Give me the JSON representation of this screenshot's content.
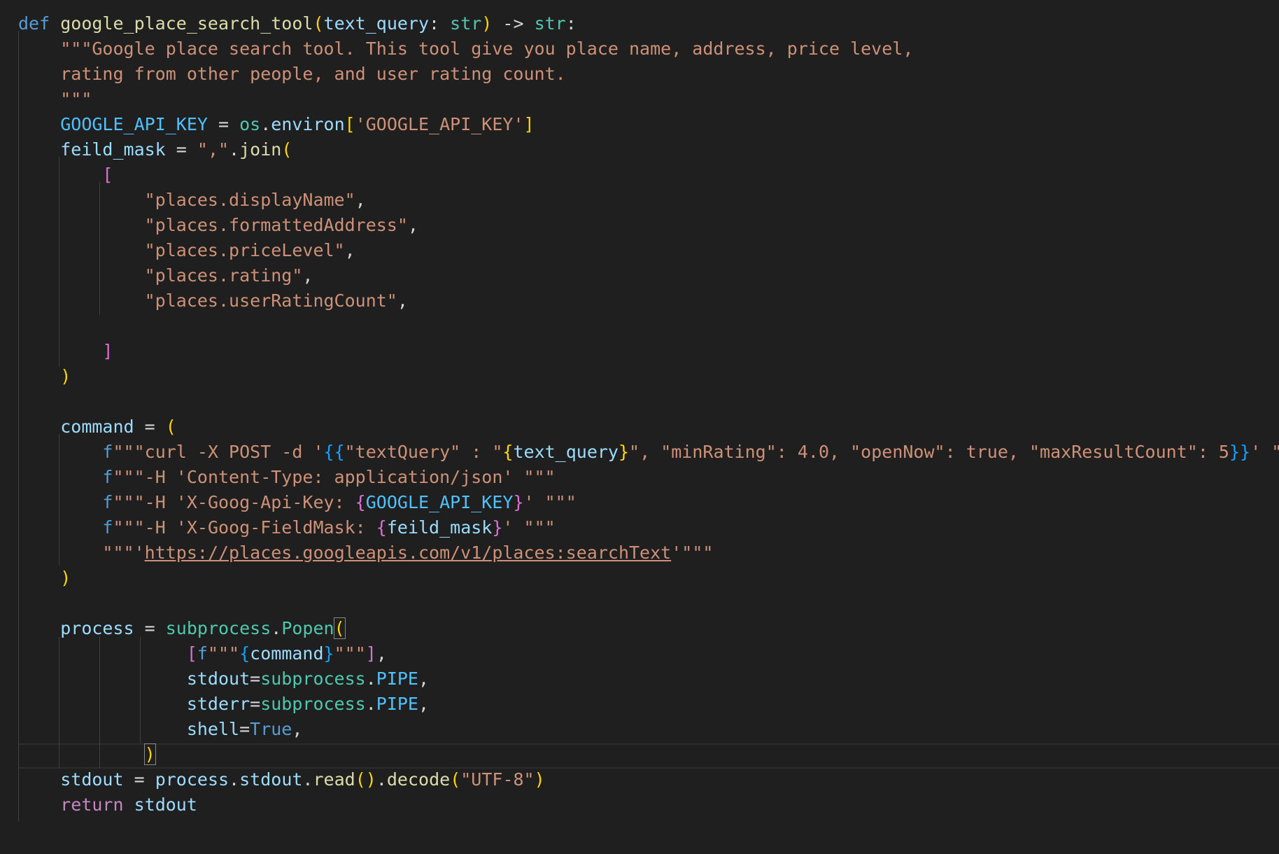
{
  "editor": {
    "language": "python",
    "theme_colors": {
      "background": "#1f1f1f",
      "keyword": "#569cd6",
      "control": "#c586c0",
      "function": "#dcdcaa",
      "parameter": "#9cdcfe",
      "type": "#4ec9b0",
      "string": "#ce9178",
      "bracket_level_1": "#ffd700",
      "bracket_level_2": "#da70d6",
      "bracket_level_3": "#179fff"
    },
    "active_line": 30,
    "lines": [
      [
        [
          "kw",
          "def"
        ],
        [
          "op",
          " "
        ],
        [
          "fn",
          "google_place_search_tool"
        ],
        [
          "brk1",
          "("
        ],
        [
          "par",
          "text_query"
        ],
        [
          "op",
          ": "
        ],
        [
          "type",
          "str"
        ],
        [
          "brk1",
          ")"
        ],
        [
          "op",
          " -> "
        ],
        [
          "type",
          "str"
        ],
        [
          "op",
          ":"
        ]
      ],
      [
        [
          "op",
          "    "
        ],
        [
          "str",
          "\"\"\"Google place search tool. This tool give you place name, address, price level,"
        ]
      ],
      [
        [
          "op",
          "    "
        ],
        [
          "str",
          "rating from other people, and user rating count."
        ]
      ],
      [
        [
          "op",
          "    "
        ],
        [
          "str",
          "\"\"\""
        ]
      ],
      [
        [
          "op",
          "    "
        ],
        [
          "const",
          "GOOGLE_API_KEY"
        ],
        [
          "op",
          " = "
        ],
        [
          "type",
          "os"
        ],
        [
          "op",
          "."
        ],
        [
          "var",
          "environ"
        ],
        [
          "brk1",
          "["
        ],
        [
          "str",
          "'GOOGLE_API_KEY'"
        ],
        [
          "brk1",
          "]"
        ]
      ],
      [
        [
          "op",
          "    "
        ],
        [
          "var",
          "feild_mask"
        ],
        [
          "op",
          " = "
        ],
        [
          "str",
          "\",\""
        ],
        [
          "op",
          "."
        ],
        [
          "fn",
          "join"
        ],
        [
          "brk1",
          "("
        ]
      ],
      [
        [
          "op",
          "        "
        ],
        [
          "brk2",
          "["
        ]
      ],
      [
        [
          "op",
          "            "
        ],
        [
          "str",
          "\"places.displayName\""
        ],
        [
          "op",
          ","
        ]
      ],
      [
        [
          "op",
          "            "
        ],
        [
          "str",
          "\"places.formattedAddress\""
        ],
        [
          "op",
          ","
        ]
      ],
      [
        [
          "op",
          "            "
        ],
        [
          "str",
          "\"places.priceLevel\""
        ],
        [
          "op",
          ","
        ]
      ],
      [
        [
          "op",
          "            "
        ],
        [
          "str",
          "\"places.rating\""
        ],
        [
          "op",
          ","
        ]
      ],
      [
        [
          "op",
          "            "
        ],
        [
          "str",
          "\"places.userRatingCount\""
        ],
        [
          "op",
          ","
        ]
      ],
      [],
      [
        [
          "op",
          "        "
        ],
        [
          "brk2",
          "]"
        ]
      ],
      [
        [
          "op",
          "    "
        ],
        [
          "brk1",
          ")"
        ]
      ],
      [],
      [
        [
          "op",
          "    "
        ],
        [
          "var",
          "command"
        ],
        [
          "op",
          " = "
        ],
        [
          "brk1",
          "("
        ]
      ],
      [
        [
          "op",
          "        "
        ],
        [
          "fs",
          "f"
        ],
        [
          "str",
          "\"\"\"curl -X POST -d '"
        ],
        [
          "brk3",
          "{{"
        ],
        [
          "str",
          "\"textQuery\" : \""
        ],
        [
          "brk1",
          "{"
        ],
        [
          "var",
          "text_query"
        ],
        [
          "brk1",
          "}"
        ],
        [
          "str",
          "\", \"minRating\": 4.0, \"openNow\": true, \"maxResultCount\": 5"
        ],
        [
          "brk3",
          "}}"
        ],
        [
          "str",
          "' \"\"\""
        ]
      ],
      [
        [
          "op",
          "        "
        ],
        [
          "fs",
          "f"
        ],
        [
          "str",
          "\"\"\"-H 'Content-Type: application/json' \"\"\""
        ]
      ],
      [
        [
          "op",
          "        "
        ],
        [
          "fs",
          "f"
        ],
        [
          "str",
          "\"\"\"-H 'X-Goog-Api-Key: "
        ],
        [
          "brk2",
          "{"
        ],
        [
          "const",
          "GOOGLE_API_KEY"
        ],
        [
          "brk2",
          "}"
        ],
        [
          "str",
          "' \"\"\""
        ]
      ],
      [
        [
          "op",
          "        "
        ],
        [
          "fs",
          "f"
        ],
        [
          "str",
          "\"\"\"-H 'X-Goog-FieldMask: "
        ],
        [
          "brk2",
          "{"
        ],
        [
          "var",
          "feild_mask"
        ],
        [
          "brk2",
          "}"
        ],
        [
          "str",
          "' \"\"\""
        ]
      ],
      [
        [
          "op",
          "        "
        ],
        [
          "str",
          "\"\"\"'"
        ],
        [
          "url",
          "https://places.googleapis.com/v1/places:searchText"
        ],
        [
          "str",
          "'\"\"\""
        ]
      ],
      [
        [
          "op",
          "    "
        ],
        [
          "brk1",
          ")"
        ]
      ],
      [],
      [
        [
          "op",
          "    "
        ],
        [
          "var",
          "process"
        ],
        [
          "op",
          " = "
        ],
        [
          "type",
          "subprocess"
        ],
        [
          "op",
          "."
        ],
        [
          "type",
          "Popen"
        ],
        [
          "brk1bm",
          "("
        ]
      ],
      [
        [
          "op",
          "                "
        ],
        [
          "brk2",
          "["
        ],
        [
          "fs",
          "f"
        ],
        [
          "str",
          "\"\"\""
        ],
        [
          "brk3",
          "{"
        ],
        [
          "var",
          "command"
        ],
        [
          "brk3",
          "}"
        ],
        [
          "str",
          "\"\"\""
        ],
        [
          "brk2",
          "]"
        ],
        [
          "op",
          ","
        ]
      ],
      [
        [
          "op",
          "                "
        ],
        [
          "par",
          "stdout"
        ],
        [
          "op",
          "="
        ],
        [
          "type",
          "subprocess"
        ],
        [
          "op",
          "."
        ],
        [
          "const",
          "PIPE"
        ],
        [
          "op",
          ","
        ]
      ],
      [
        [
          "op",
          "                "
        ],
        [
          "par",
          "stderr"
        ],
        [
          "op",
          "="
        ],
        [
          "type",
          "subprocess"
        ],
        [
          "op",
          "."
        ],
        [
          "const",
          "PIPE"
        ],
        [
          "op",
          ","
        ]
      ],
      [
        [
          "op",
          "                "
        ],
        [
          "par",
          "shell"
        ],
        [
          "op",
          "="
        ],
        [
          "kw",
          "True"
        ],
        [
          "op",
          ","
        ]
      ],
      [
        [
          "op",
          "            "
        ],
        [
          "brk1bm",
          ")"
        ]
      ],
      [
        [
          "op",
          "    "
        ],
        [
          "var",
          "stdout"
        ],
        [
          "op",
          " = "
        ],
        [
          "var",
          "process"
        ],
        [
          "op",
          "."
        ],
        [
          "var",
          "stdout"
        ],
        [
          "op",
          "."
        ],
        [
          "fn",
          "read"
        ],
        [
          "brk1",
          "()"
        ],
        [
          "op",
          "."
        ],
        [
          "fn",
          "decode"
        ],
        [
          "brk1",
          "("
        ],
        [
          "str",
          "\"UTF-8\""
        ],
        [
          "brk1",
          ")"
        ]
      ],
      [
        [
          "op",
          "    "
        ],
        [
          "ctrl",
          "return"
        ],
        [
          "op",
          " "
        ],
        [
          "var",
          "stdout"
        ]
      ]
    ]
  }
}
